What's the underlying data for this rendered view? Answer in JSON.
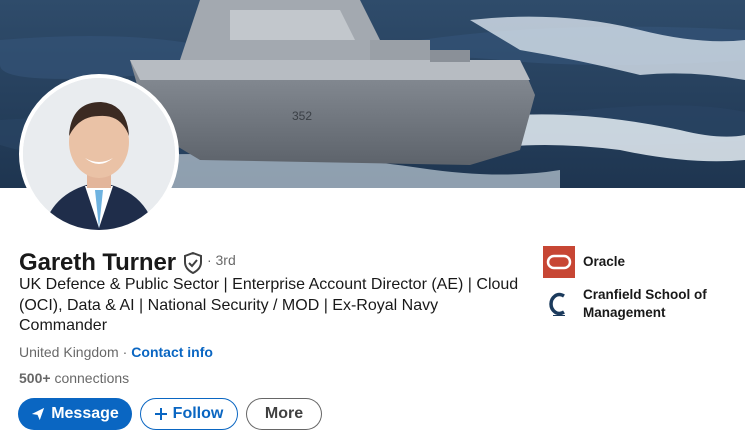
{
  "profile": {
    "name": "Gareth Turner",
    "degree": "· 3rd",
    "headline": "UK Defence & Public Sector | Enterprise Account Director (AE) | Cloud (OCI), Data & AI | National Security / MOD | Ex-Royal Navy Commander",
    "location": "United Kingdom",
    "location_separator": "·",
    "contact_info_label": "Contact info",
    "connections_count": "500+",
    "connections_label": "connections"
  },
  "actions": {
    "message_label": "Message",
    "follow_label": "Follow",
    "more_label": "More"
  },
  "organizations": [
    {
      "name": "Oracle",
      "icon": "oracle-logo",
      "color": "#c74634"
    },
    {
      "name": "Cranfield School of Management",
      "icon": "cranfield-logo",
      "color": "#1b3a5c"
    }
  ],
  "colors": {
    "primary": "#0a66c2",
    "text_secondary": "#666666"
  }
}
